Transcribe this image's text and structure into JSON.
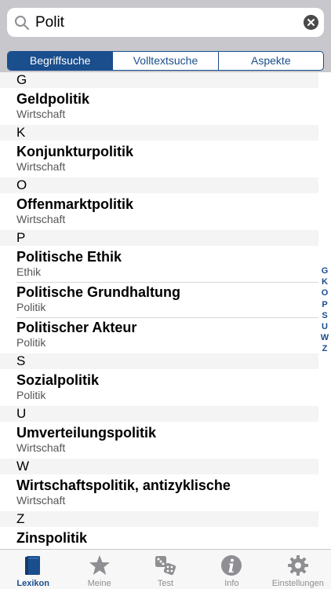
{
  "search": {
    "value": "Polit"
  },
  "segments": [
    {
      "label": "Begriffsuche",
      "active": true
    },
    {
      "label": "Volltextsuche",
      "active": false
    },
    {
      "label": "Aspekte",
      "active": false
    }
  ],
  "list": {
    "headers": [
      "G",
      "K",
      "O",
      "P",
      "S",
      "U",
      "W",
      "Z"
    ],
    "entries": [
      {
        "title": "Geldpolitik",
        "category": "Wirtschaft"
      },
      {
        "title": "Konjunkturpolitik",
        "category": "Wirtschaft"
      },
      {
        "title": "Offenmarktpolitik",
        "category": "Wirtschaft"
      },
      {
        "title": "Politische Ethik",
        "category": "Ethik"
      },
      {
        "title": "Politische Grundhaltung",
        "category": "Politik"
      },
      {
        "title": "Politischer Akteur",
        "category": "Politik"
      },
      {
        "title": "Sozialpolitik",
        "category": "Politik"
      },
      {
        "title": "Umverteilungspolitik",
        "category": "Wirtschaft"
      },
      {
        "title": "Wirtschaftspolitik, antizyklische",
        "category": "Wirtschaft"
      },
      {
        "title": "Zinspolitik",
        "category": ""
      }
    ]
  },
  "index": [
    "G",
    "K",
    "O",
    "P",
    "S",
    "U",
    "W",
    "Z"
  ],
  "tabs": [
    {
      "label": "Lexikon",
      "icon": "book-icon"
    },
    {
      "label": "Meine",
      "icon": "star-icon"
    },
    {
      "label": "Test",
      "icon": "dice-icon"
    },
    {
      "label": "Info",
      "icon": "info-icon"
    },
    {
      "label": "Einstellungen",
      "icon": "gear-icon"
    }
  ],
  "colors": {
    "accent": "#1a4e8c",
    "header_bg": "#f4f4f4",
    "top_bg": "#c8c7cc"
  }
}
